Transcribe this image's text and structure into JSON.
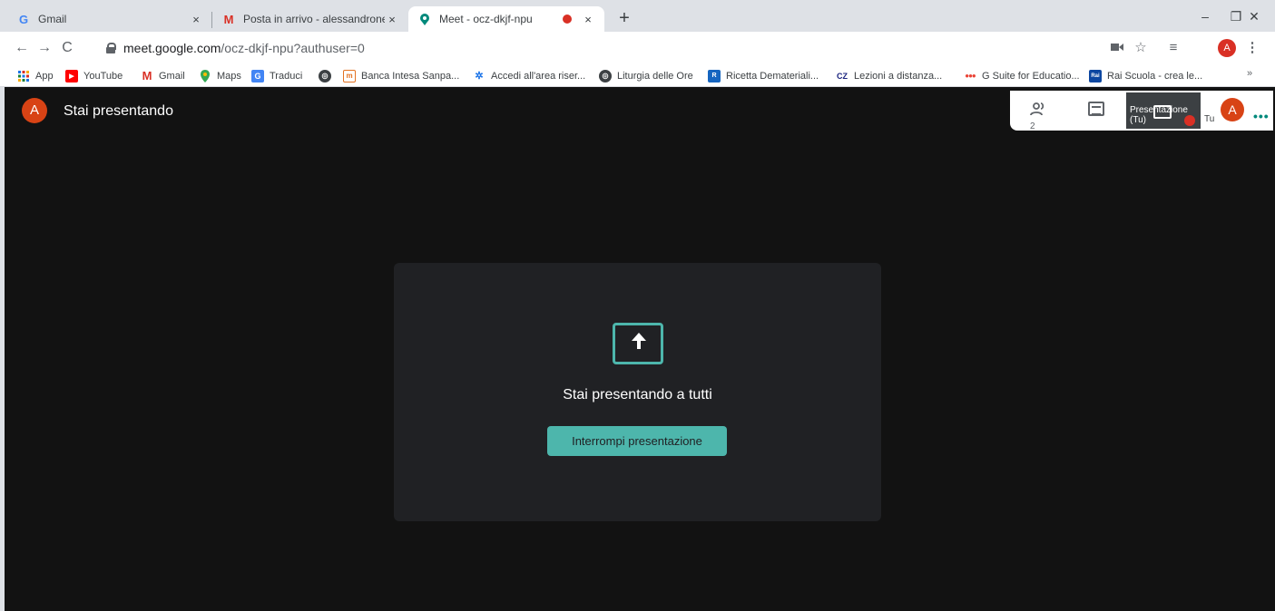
{
  "browser": {
    "tabs": [
      {
        "title": "Gmail",
        "favicon": "google-g-icon",
        "close": "×"
      },
      {
        "title": "Posta in arrivo - alessandronenci",
        "favicon": "gmail-m-icon",
        "close": "×"
      },
      {
        "title": "Meet - ocz-dkjf-npu",
        "favicon": "meet-icon",
        "close": "×",
        "active": true,
        "recording": true
      }
    ],
    "new_tab": "+",
    "window_controls": {
      "minimize": "–",
      "maximize": "❐",
      "close": "✕"
    },
    "toolbar": {
      "back": "←",
      "forward": "→",
      "reload": "C",
      "url_host": "meet.google.com",
      "url_path": "/ocz-dkjf-npu?authuser=0",
      "profile_initial": "A",
      "menu": "⋮"
    },
    "bookmarks": [
      {
        "label": "App",
        "icon": "apps-grid-icon"
      },
      {
        "label": "YouTube",
        "icon": "youtube-icon"
      },
      {
        "label": "Gmail",
        "icon": "gmail-m-icon"
      },
      {
        "label": "Maps",
        "icon": "maps-pin-icon"
      },
      {
        "label": "Traduci",
        "icon": "translate-icon"
      },
      {
        "label": "",
        "icon": "globe-icon"
      },
      {
        "label": "Banca Intesa Sanpa...",
        "icon": "intesa-icon"
      },
      {
        "label": "Accedi all'area riser...",
        "icon": "star-cluster-icon"
      },
      {
        "label": "Liturgia delle Ore",
        "icon": "globe-icon"
      },
      {
        "label": "Ricetta Demateriali...",
        "icon": "ricetta-icon"
      },
      {
        "label": "Lezioni a distanza...",
        "icon": "cz-icon"
      },
      {
        "label": "G Suite for Educatio...",
        "icon": "gsuite-icon"
      },
      {
        "label": "Rai Scuola - crea le...",
        "icon": "rai-icon"
      }
    ],
    "bookmarks_more": "»"
  },
  "meet": {
    "user_initial": "A",
    "status": "Stai presentando",
    "participants_count": "2",
    "thumb_label": "Presentazione (Tu)",
    "self_label": "Tu",
    "self_initial": "A",
    "more": "•••",
    "present_title": "Stai presentando a tutti",
    "stop_button": "Interrompi presentazione"
  },
  "colors": {
    "accent": "#4db6ac",
    "background": "#121212",
    "card": "#202124",
    "avatar": "#d84315"
  }
}
